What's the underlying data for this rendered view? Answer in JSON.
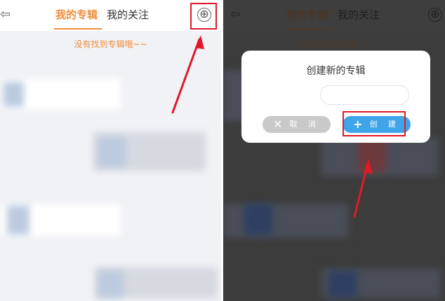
{
  "left": {
    "back_icon": "⇦",
    "tabs": [
      {
        "label": "我的专辑",
        "active": true
      },
      {
        "label": "我的关注",
        "active": false
      }
    ],
    "add_icon": "⊕",
    "empty_message": "没有找到专辑哦~~"
  },
  "right": {
    "back_icon": "⇦",
    "tabs": [
      {
        "label": "我的专辑",
        "active": true
      },
      {
        "label": "我的关注",
        "active": false
      }
    ],
    "add_icon": "⊕",
    "empty_message": "没有找到专辑哦~~",
    "dialog": {
      "title": "创建新的专辑",
      "input_value": "",
      "cancel_icon": "✕",
      "cancel_label": "取 消",
      "create_icon": "+",
      "create_label": "创 建"
    }
  },
  "colors": {
    "accent": "#ef8d3a",
    "highlight": "#e0192a",
    "create_button": "#3ea5e8",
    "cancel_button": "#c9c9c9"
  }
}
